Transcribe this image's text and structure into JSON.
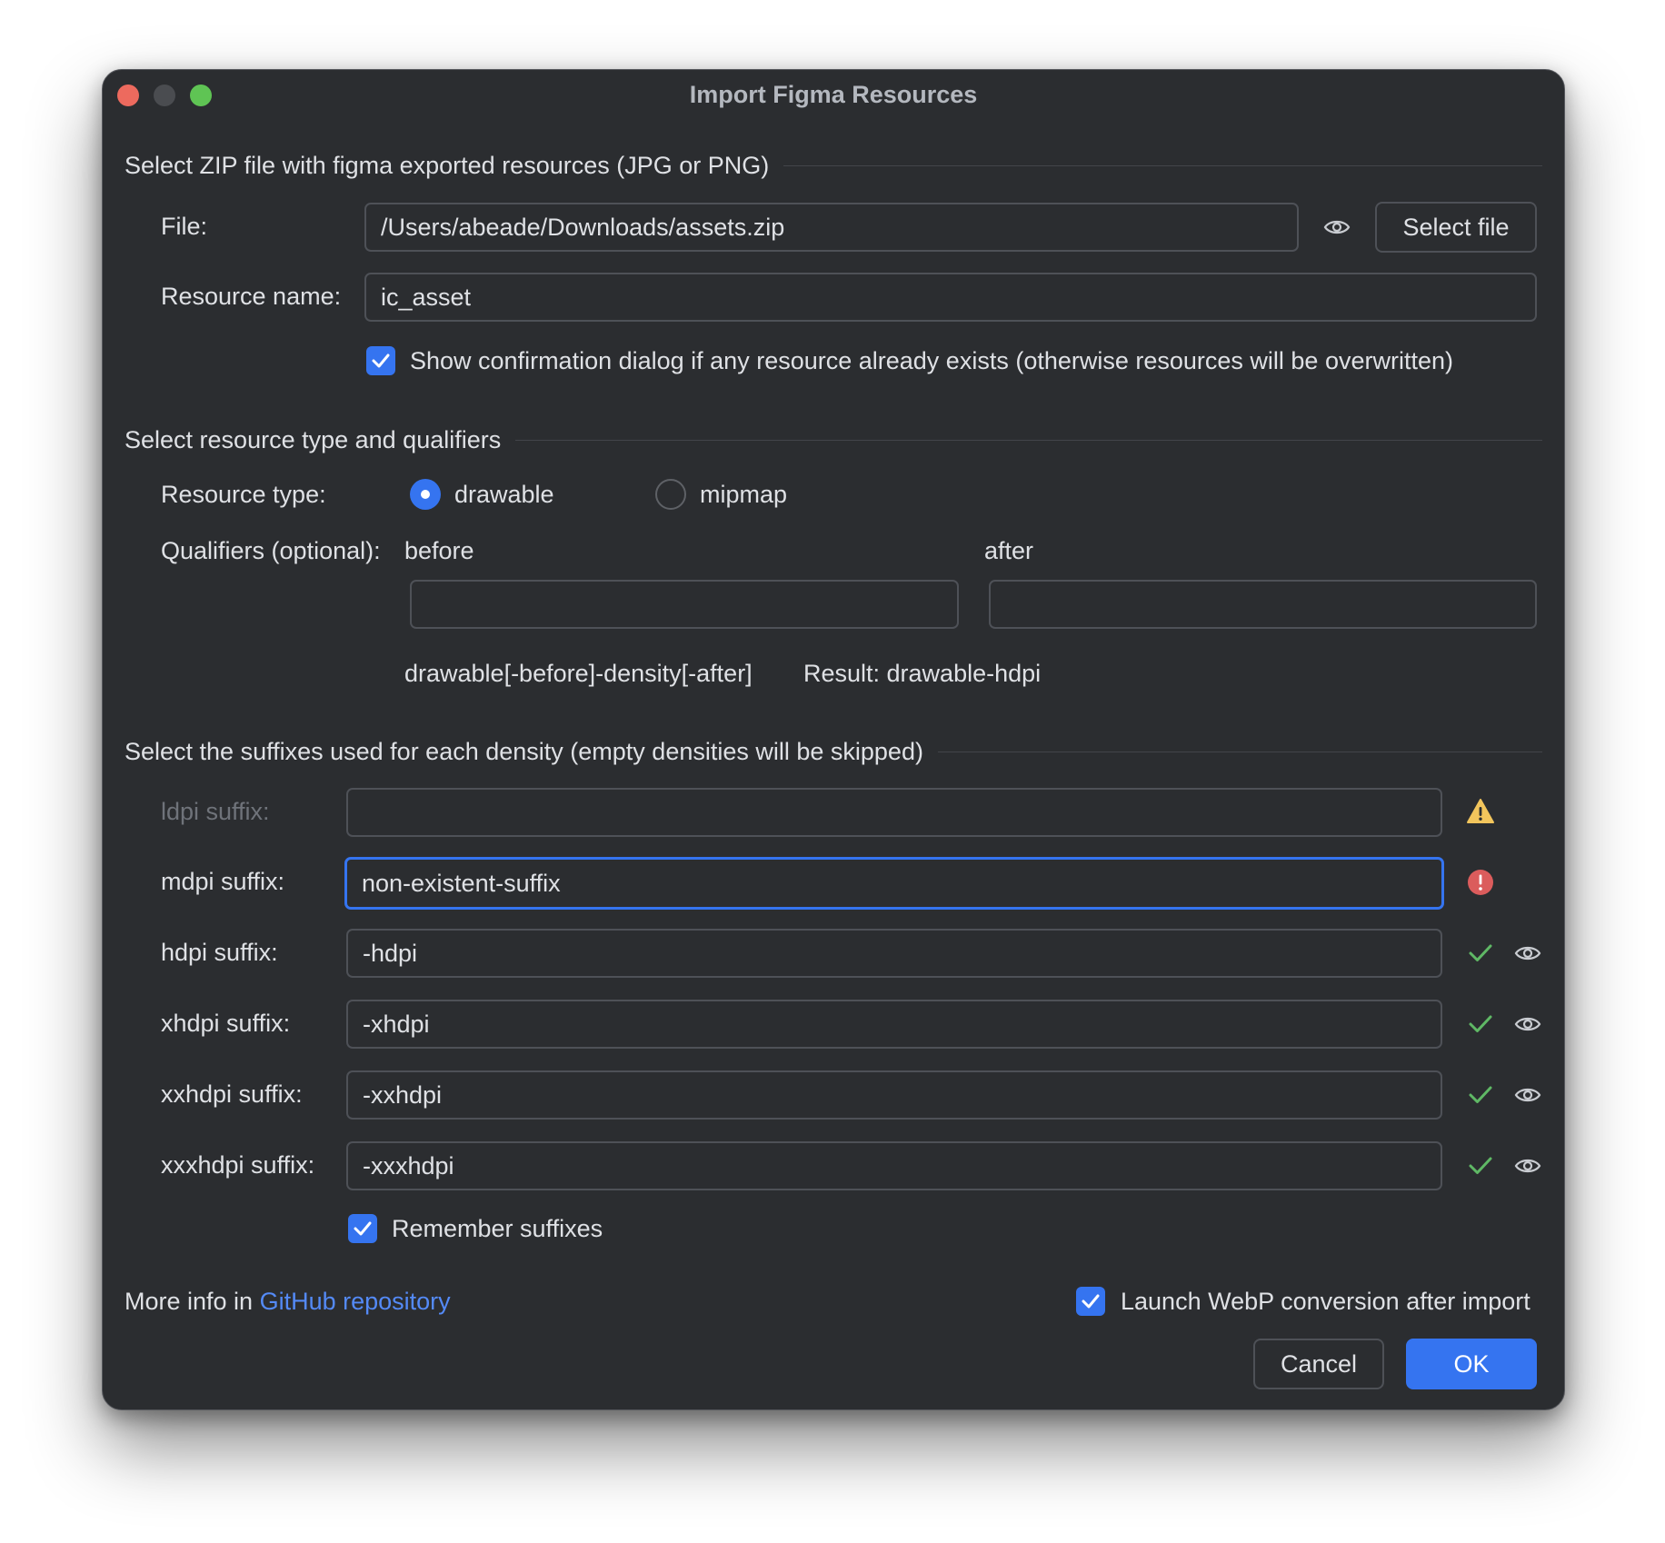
{
  "window": {
    "title": "Import Figma Resources"
  },
  "file_section": {
    "header": "Select ZIP file with figma exported resources (JPG or PNG)",
    "file_label": "File:",
    "file_value": "/Users/abeade/Downloads/assets.zip",
    "select_file_label": "Select file",
    "resource_name_label": "Resource name:",
    "resource_name_value": "ic_asset",
    "confirm_checkbox_label": "Show confirmation dialog if any resource already exists (otherwise resources will be overwritten)"
  },
  "type_section": {
    "header": "Select resource type and qualifiers",
    "resource_type_label": "Resource type:",
    "option_drawable": "drawable",
    "option_mipmap": "mipmap",
    "qualifiers_label": "Qualifiers (optional):",
    "before_label": "before",
    "after_label": "after",
    "before_value": "",
    "after_value": "",
    "pattern_text": "drawable[-before]-density[-after]",
    "result_text": "Result: drawable-hdpi"
  },
  "suffix_section": {
    "header": "Select the suffixes used for each density (empty densities will be skipped)",
    "rows": [
      {
        "label": "ldpi suffix:",
        "value": "",
        "status": "warning"
      },
      {
        "label": "mdpi suffix:",
        "value": "non-existent-suffix",
        "status": "error"
      },
      {
        "label": "hdpi suffix:",
        "value": "-hdpi",
        "status": "ok"
      },
      {
        "label": "xhdpi suffix:",
        "value": "-xhdpi",
        "status": "ok"
      },
      {
        "label": "xxhdpi suffix:",
        "value": "-xxhdpi",
        "status": "ok"
      },
      {
        "label": "xxxhdpi suffix:",
        "value": "-xxxhdpi",
        "status": "ok"
      }
    ],
    "remember_label": "Remember suffixes"
  },
  "footer": {
    "more_info_prefix": "More info in ",
    "github_link": "GitHub repository",
    "webp_label": "Launch WebP conversion after import",
    "cancel_label": "Cancel",
    "ok_label": "OK"
  },
  "colors": {
    "accent": "#3574f0",
    "background": "#2b2d30",
    "ok": "#5fb865",
    "warning": "#f2c55c",
    "error": "#db5c5c"
  }
}
